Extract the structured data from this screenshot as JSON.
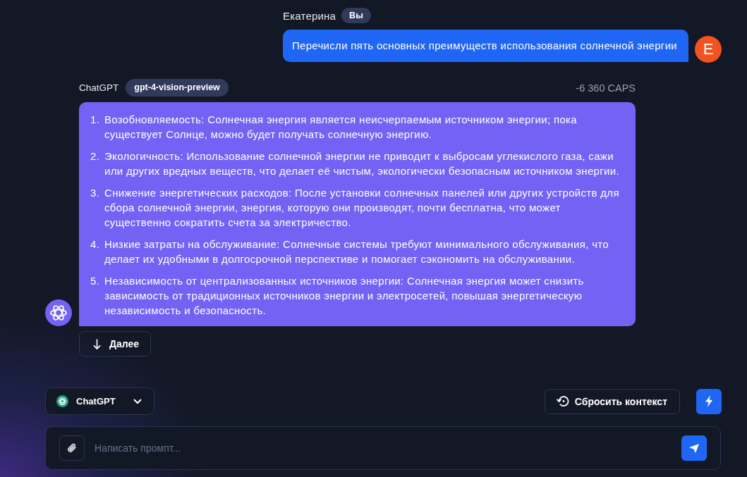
{
  "user_message": {
    "author": "Екатерина",
    "badge": "Вы",
    "avatar_letter": "Е",
    "text": "Перечисли пять основных преимуществ использования солнечной энергии"
  },
  "assistant_message": {
    "author": "ChatGPT",
    "model_badge": "gpt-4-vision-preview",
    "cost": "-6 360 CAPS",
    "items": [
      {
        "number": "1.",
        "text": "Возобновляемость: Солнечная энергия является неисчерпаемым источником энергии; пока существует Солнце, можно будет получать солнечную энергию."
      },
      {
        "number": "2.",
        "text": "Экологичность: Использование солнечной энергии не приводит к выбросам углекислого газа, сажи или других вредных веществ, что делает её чистым, экологически безопасным источником энергии."
      },
      {
        "number": "3.",
        "text": "Снижение энергетических расходов: После установки солнечных панелей или других устройств для сбора солнечной энергии, энергия, которую они производят, почти бесплатна, что может существенно сократить счета за электричество."
      },
      {
        "number": "4.",
        "text": "Низкие затраты на обслуживание: Солнечные системы требуют минимального обслуживания, что делает их удобными в долгосрочной перспективе и помогает сэкономить на обслуживании."
      },
      {
        "number": "5.",
        "text": "Независимость от централизованных источников энергии: Солнечная энергия может снизить зависимость от традиционных источников энергии и электросетей, повышая энергетическую независимость и безопасность."
      }
    ],
    "continue_button": {
      "label": "Далее"
    }
  },
  "model_selector": {
    "label": "ChatGPT"
  },
  "reset_button": {
    "label": "Сбросить контекст"
  },
  "prompt_field": {
    "placeholder": "Написать промпт..."
  }
}
